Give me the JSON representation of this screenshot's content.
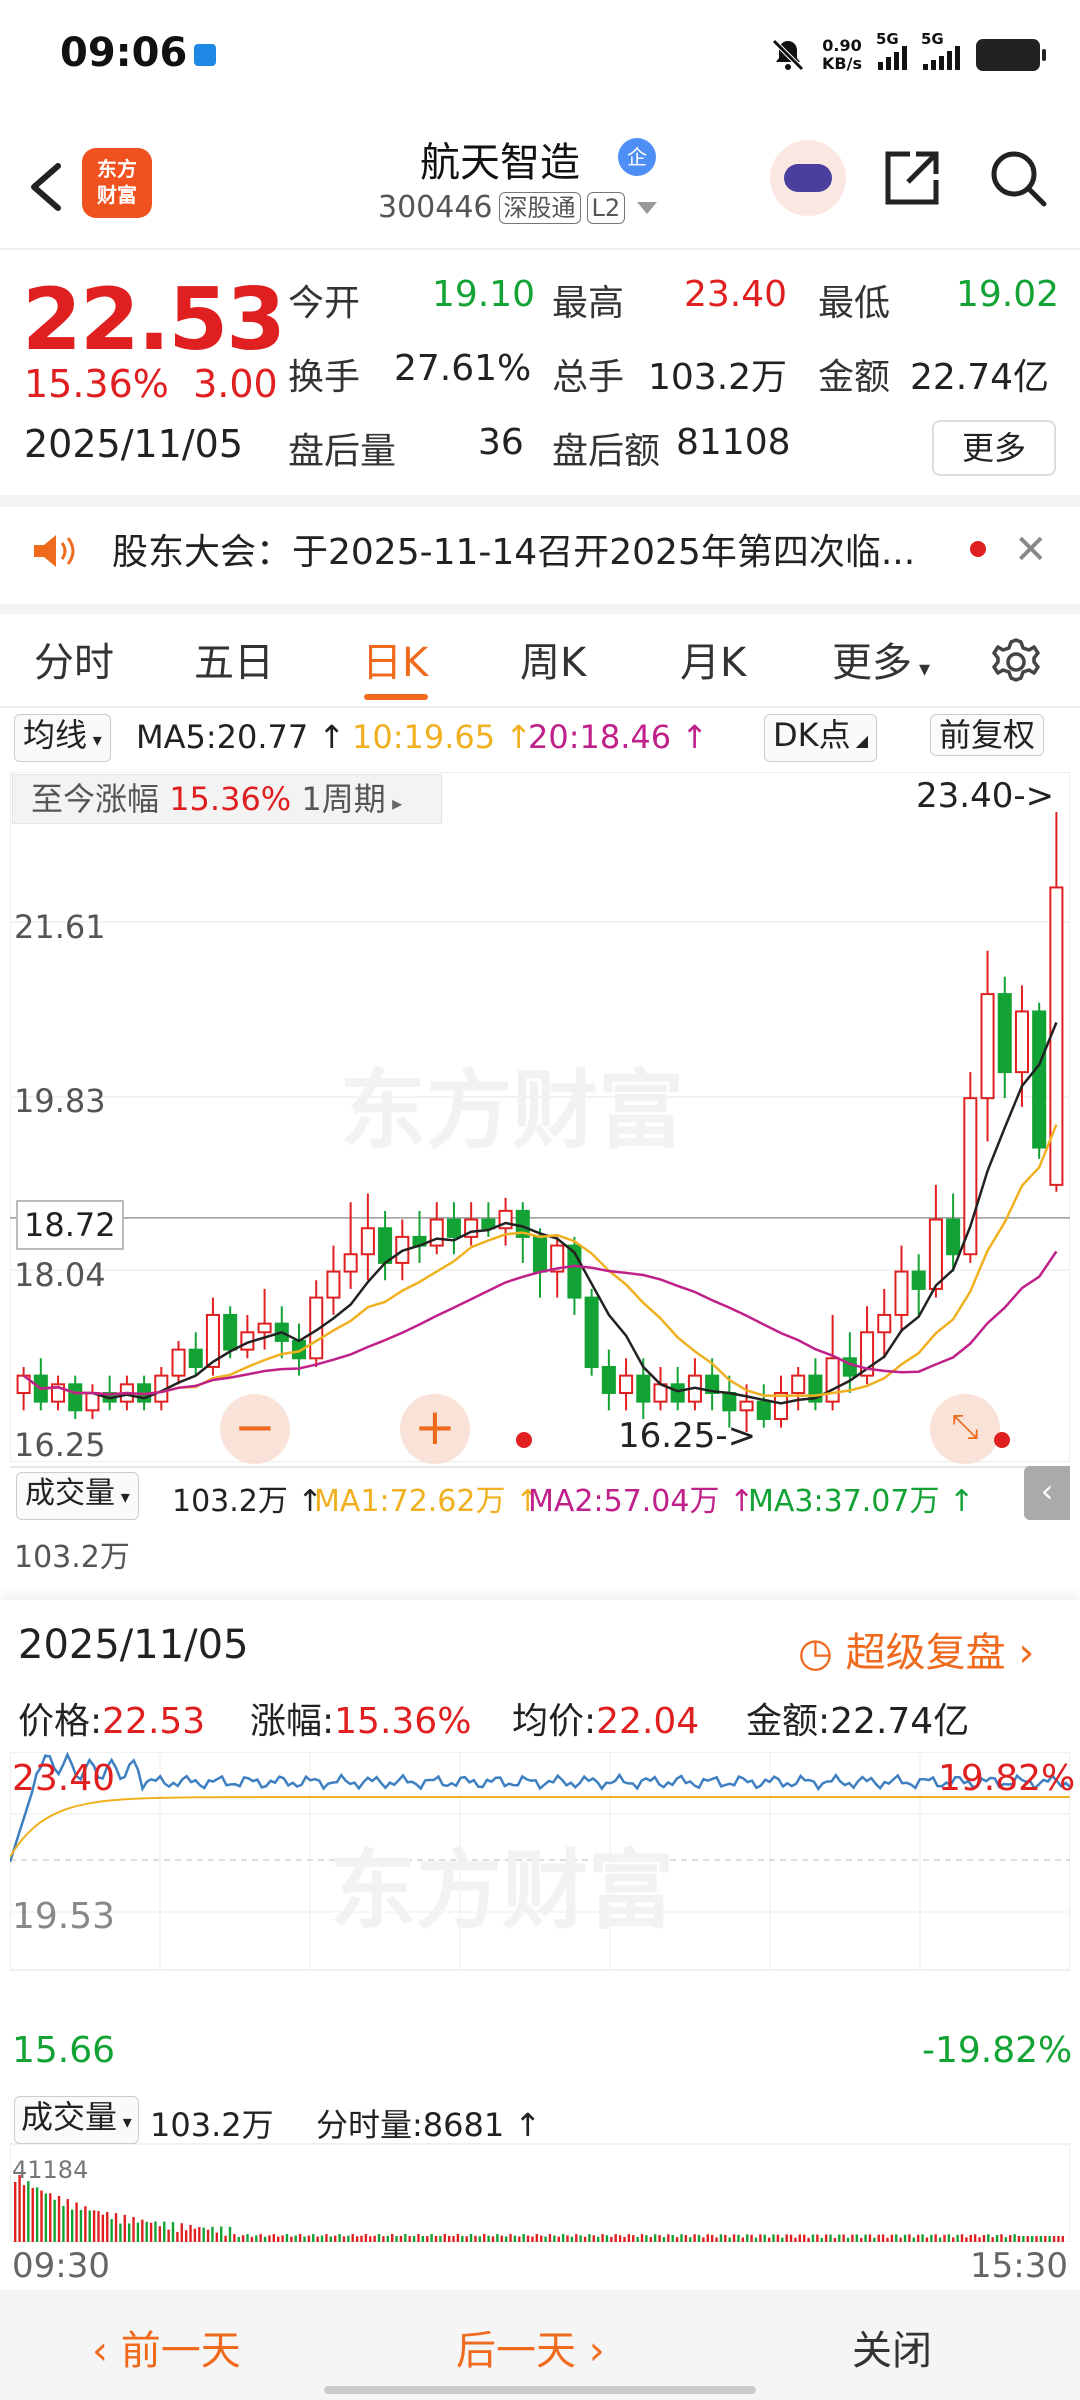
{
  "status_bar": {
    "time": "09:06",
    "net_speed": "0.90",
    "net_unit": "KB/s",
    "sim1": "5G",
    "sim2": "5G"
  },
  "header": {
    "logo_line1": "东方",
    "logo_line2": "财富",
    "stock_name": "航天智造",
    "badge": "企",
    "stock_code": "300446",
    "tag_market": "深股通",
    "tag_level": "L2"
  },
  "quote": {
    "price": "22.53",
    "change_pct": "15.36%",
    "change_abs": "3.00",
    "date": "2025/11/05",
    "open_label": "今开",
    "open": "19.10",
    "high_label": "最高",
    "high": "23.40",
    "low_label": "最低",
    "low": "19.02",
    "turnover_label": "换手",
    "turnover": "27.61%",
    "volume_label": "总手",
    "volume": "103.2万",
    "amount_label": "金额",
    "amount": "22.74亿",
    "after_vol_label": "盘后量",
    "after_vol": "36",
    "after_amt_label": "盘后额",
    "after_amt": "81108",
    "more": "更多"
  },
  "notice": {
    "text": "股东大会：于2025-11-14召开2025年第四次临..."
  },
  "tabs": [
    "分时",
    "五日",
    "日K",
    "周K",
    "月K",
    "更多"
  ],
  "active_tab": "日K",
  "ma_bar": {
    "selector": "均线",
    "ma5": "MA5:20.77 ↑",
    "ma10": "10:19.65 ↑",
    "ma20": "20:18.46 ↑",
    "dk": "DK点",
    "adjust": "前复权"
  },
  "kchart": {
    "range_label": "至今涨幅",
    "range_pct": "15.36%",
    "range_period": "1周期",
    "max_marker": "23.40->",
    "min_marker": "16.25->",
    "y_labels": [
      "21.61",
      "19.83",
      "18.04",
      "16.25"
    ],
    "crosshair_price": "18.72",
    "watermark": "东方财富",
    "vol_selector": "成交量",
    "vol_value": "103.2万 ↑",
    "vol_ma1": "MA1:72.62万 ↑",
    "vol_ma2": "MA2:57.04万 ↑",
    "vol_ma3": "MA3:37.07万 ↑",
    "vol_axis": "103.2万"
  },
  "chart_data": {
    "type": "candlestick",
    "title": "",
    "ylim": [
      16.25,
      23.4
    ],
    "grid": true,
    "candles": [
      [
        16.7,
        16.9,
        16.5,
        17.0
      ],
      [
        16.9,
        16.6,
        16.5,
        17.1
      ],
      [
        16.6,
        16.8,
        16.5,
        16.9
      ],
      [
        16.8,
        16.5,
        16.4,
        16.9
      ],
      [
        16.5,
        16.7,
        16.4,
        16.8
      ],
      [
        16.7,
        16.6,
        16.5,
        16.9
      ],
      [
        16.6,
        16.8,
        16.5,
        16.9
      ],
      [
        16.8,
        16.6,
        16.5,
        16.9
      ],
      [
        16.6,
        16.9,
        16.5,
        17.0
      ],
      [
        16.9,
        17.2,
        16.8,
        17.3
      ],
      [
        17.2,
        17.0,
        16.9,
        17.4
      ],
      [
        17.0,
        17.6,
        16.9,
        17.8
      ],
      [
        17.6,
        17.2,
        17.1,
        17.7
      ],
      [
        17.2,
        17.4,
        17.1,
        17.6
      ],
      [
        17.4,
        17.5,
        17.2,
        17.9
      ],
      [
        17.5,
        17.3,
        17.1,
        17.7
      ],
      [
        17.3,
        17.1,
        16.9,
        17.5
      ],
      [
        17.1,
        17.8,
        17.0,
        18.0
      ],
      [
        17.8,
        18.1,
        17.6,
        18.4
      ],
      [
        18.1,
        18.3,
        17.9,
        18.9
      ],
      [
        18.3,
        18.6,
        18.0,
        19.0
      ],
      [
        18.6,
        18.2,
        18.0,
        18.8
      ],
      [
        18.2,
        18.5,
        18.0,
        18.7
      ],
      [
        18.5,
        18.4,
        18.2,
        18.8
      ],
      [
        18.4,
        18.7,
        18.3,
        18.9
      ],
      [
        18.7,
        18.5,
        18.3,
        18.9
      ],
      [
        18.5,
        18.7,
        18.4,
        18.9
      ],
      [
        18.7,
        18.6,
        18.5,
        18.9
      ],
      [
        18.6,
        18.8,
        18.4,
        18.95
      ],
      [
        18.8,
        18.5,
        18.2,
        18.9
      ],
      [
        18.5,
        18.1,
        17.8,
        18.6
      ],
      [
        18.1,
        18.4,
        17.8,
        18.5
      ],
      [
        18.4,
        17.8,
        17.6,
        18.5
      ],
      [
        17.8,
        17.0,
        16.9,
        17.9
      ],
      [
        17.0,
        16.7,
        16.5,
        17.2
      ],
      [
        16.7,
        16.9,
        16.5,
        17.1
      ],
      [
        16.9,
        16.6,
        16.4,
        17.1
      ],
      [
        16.6,
        16.8,
        16.5,
        17.0
      ],
      [
        16.8,
        16.6,
        16.5,
        17.0
      ],
      [
        16.6,
        16.9,
        16.5,
        17.1
      ],
      [
        16.9,
        16.7,
        16.5,
        17.1
      ],
      [
        16.7,
        16.5,
        16.3,
        16.9
      ],
      [
        16.5,
        16.6,
        16.25,
        16.8
      ],
      [
        16.6,
        16.4,
        16.3,
        16.8
      ],
      [
        16.4,
        16.7,
        16.3,
        16.9
      ],
      [
        16.7,
        16.9,
        16.5,
        17.0
      ],
      [
        16.9,
        16.6,
        16.5,
        17.1
      ],
      [
        16.6,
        17.1,
        16.5,
        17.6
      ],
      [
        17.1,
        16.9,
        16.7,
        17.4
      ],
      [
        16.9,
        17.4,
        16.8,
        17.7
      ],
      [
        17.4,
        17.6,
        17.1,
        17.9
      ],
      [
        17.6,
        18.1,
        17.4,
        18.4
      ],
      [
        18.1,
        17.9,
        17.6,
        18.3
      ],
      [
        17.9,
        18.7,
        17.8,
        19.1
      ],
      [
        18.7,
        18.3,
        18.1,
        19.0
      ],
      [
        18.3,
        20.1,
        18.2,
        20.4
      ],
      [
        20.1,
        21.3,
        19.6,
        21.8
      ],
      [
        21.3,
        20.4,
        20.1,
        21.5
      ],
      [
        20.4,
        21.1,
        20.0,
        21.4
      ],
      [
        21.1,
        19.53,
        19.4,
        21.2
      ],
      [
        19.1,
        22.53,
        19.02,
        23.4
      ]
    ],
    "volume_max": "103.2万"
  },
  "intraday": {
    "date": "2025/11/05",
    "super_replay": "超级复盘",
    "price_label": "价格:",
    "price": "22.53",
    "chg_label": "涨幅:",
    "chg": "15.36%",
    "avg_label": "均价:",
    "avg": "22.04",
    "amount_label": "金额:",
    "amount": "22.74亿",
    "y_top": "23.40",
    "y_mid": "19.53",
    "y_bot": "15.66",
    "pct_top": "19.82%",
    "pct_bot": "-19.82%",
    "watermark": "东方财富",
    "vol_selector": "成交量",
    "vol_total": "103.2万",
    "tick_vol": "分时量:8681 ↑",
    "vol_axis": "41184",
    "t_start": "09:30",
    "t_end": "15:30"
  },
  "bottom": {
    "prev": "前一天",
    "next": "后一天",
    "close": "关闭"
  },
  "colors": {
    "up": "#e02020",
    "down": "#13a335",
    "accent": "#f06a1e",
    "ma5": "#222222",
    "ma10": "#f0b020",
    "ma20": "#c0208a"
  }
}
